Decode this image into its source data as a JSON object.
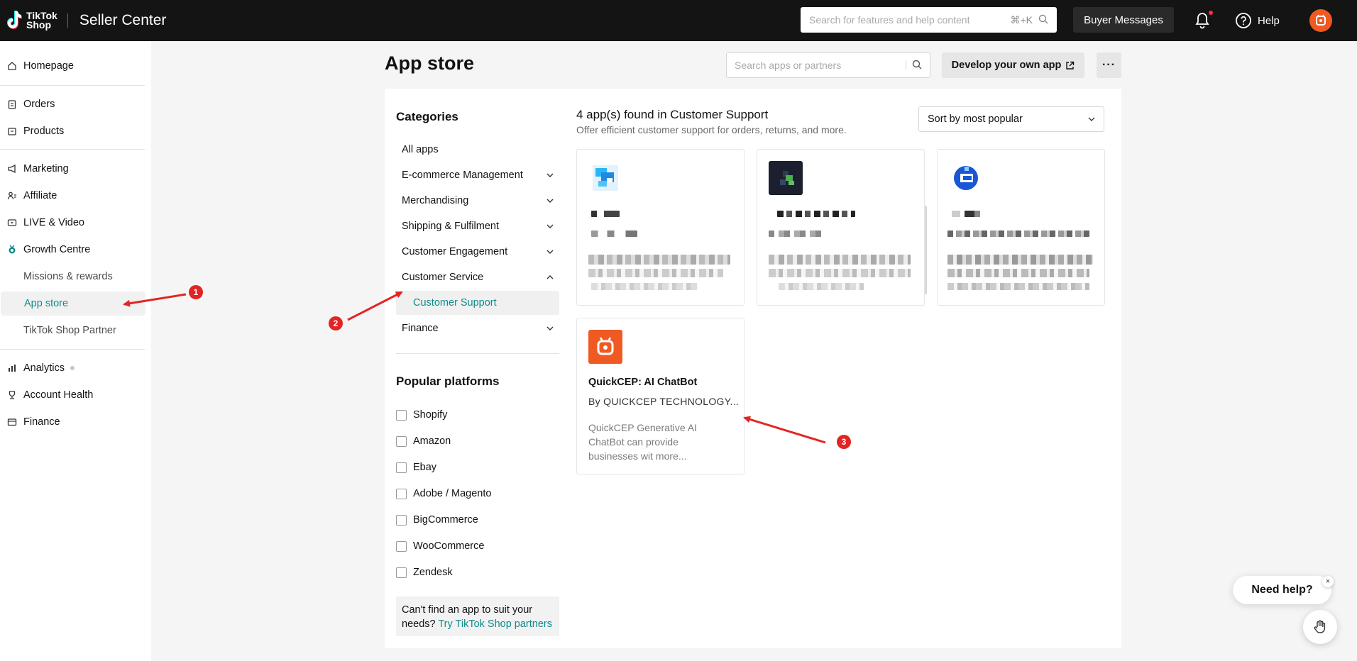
{
  "header": {
    "logo_text_line1": "TikTok",
    "logo_text_line2": "Shop",
    "product_title": "Seller Center",
    "search_placeholder": "Search for features and help content",
    "search_shortcut": "⌘+K",
    "buyer_messages_label": "Buyer Messages",
    "help_label": "Help"
  },
  "sidebar": {
    "items": [
      {
        "label": "Homepage",
        "icon": "home-icon"
      },
      {
        "label": "Orders",
        "icon": "clipboard-icon"
      },
      {
        "label": "Products",
        "icon": "box-icon"
      },
      {
        "label": "Marketing",
        "icon": "megaphone-icon"
      },
      {
        "label": "Affiliate",
        "icon": "people-icon"
      },
      {
        "label": "LIVE & Video",
        "icon": "video-icon"
      },
      {
        "label": "Growth Centre",
        "icon": "medal-icon"
      },
      {
        "label": "Missions & rewards",
        "icon": ""
      },
      {
        "label": "App store",
        "icon": "",
        "active": true
      },
      {
        "label": "TikTok Shop Partner",
        "icon": ""
      },
      {
        "label": "Analytics",
        "icon": "chart-icon"
      },
      {
        "label": "Account Health",
        "icon": "trophy-icon"
      },
      {
        "label": "Finance",
        "icon": "wallet-icon"
      }
    ]
  },
  "main": {
    "title": "App store",
    "search_placeholder": "Search apps or partners",
    "develop_button_label": "Develop your own app",
    "more_button_label": "···",
    "categories_title": "Categories",
    "categories": [
      {
        "label": "All apps",
        "expandable": false
      },
      {
        "label": "E-commerce Management",
        "expandable": true
      },
      {
        "label": "Merchandising",
        "expandable": true
      },
      {
        "label": "Shipping & Fulfilment",
        "expandable": true
      },
      {
        "label": "Customer Engagement",
        "expandable": true
      },
      {
        "label": "Customer Service",
        "expandable": true,
        "expanded": true
      },
      {
        "label": "Customer Support",
        "sub": true,
        "selected": true
      },
      {
        "label": "Finance",
        "expandable": true
      }
    ],
    "platforms_title": "Popular platforms",
    "platforms": [
      "Shopify",
      "Amazon",
      "Ebay",
      "Adobe / Magento",
      "BigCommerce",
      "WooCommerce",
      "Zendesk"
    ],
    "cant_find_text": "Can't find an app to suit your needs?",
    "cant_find_link": "Try TikTok Shop partners",
    "results_title": "4 app(s) found in Customer Support",
    "results_subtitle": "Offer efficient customer support for orders, returns, and more.",
    "sort_value": "Sort by most popular",
    "apps": [
      {
        "name": "",
        "vendor": "",
        "description": "",
        "blurred": true,
        "logo_color": "#1e88e5"
      },
      {
        "name": "",
        "vendor": "",
        "description": "",
        "blurred": true,
        "logo_color": "#1b1f2e"
      },
      {
        "name": "",
        "vendor": "",
        "description": "",
        "blurred": true,
        "logo_color": "#1a57d6"
      },
      {
        "name": "QuickCEP: AI ChatBot",
        "vendor": "By QUICKCEP TECHNOLOGY...",
        "description": "QuickCEP Generative AI ChatBot can provide businesses wit more...",
        "blurred": false,
        "logo_color": "#f05a22"
      }
    ]
  },
  "annotations": [
    "1",
    "2",
    "3"
  ],
  "help_widget": {
    "label": "Need help?",
    "close": "×"
  },
  "colors": {
    "accent": "#0d8c8c",
    "annotation_red": "#e32424",
    "quickcep_orange": "#f05a22",
    "topbar": "#141414"
  }
}
